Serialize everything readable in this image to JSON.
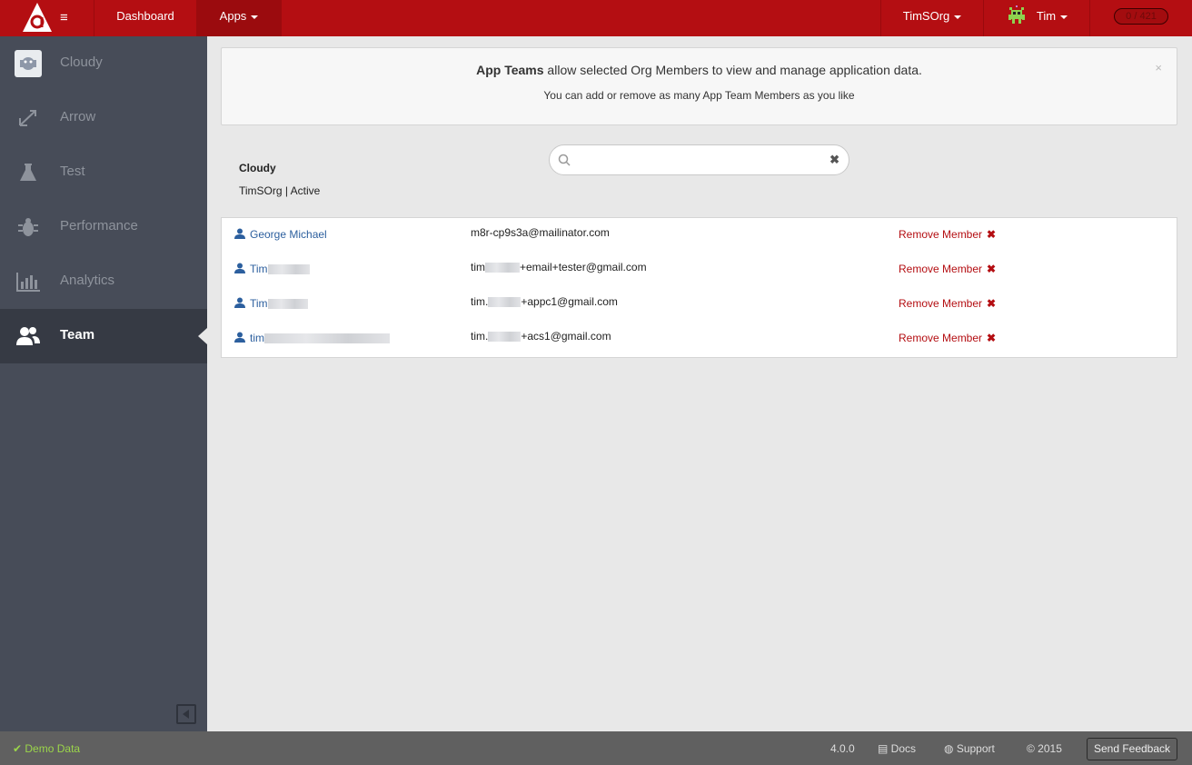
{
  "topbar": {
    "nav": [
      {
        "label": "Dashboard"
      },
      {
        "label": "Apps"
      }
    ],
    "org": "TimSOrg",
    "user": "Tim",
    "counter": "0 / 421"
  },
  "sidebar": {
    "items": [
      {
        "label": "Cloudy",
        "icon": "app-icon"
      },
      {
        "label": "Arrow",
        "icon": "arrow-icon"
      },
      {
        "label": "Test",
        "icon": "flask-icon"
      },
      {
        "label": "Performance",
        "icon": "bug-icon"
      },
      {
        "label": "Analytics",
        "icon": "bar-chart-icon"
      },
      {
        "label": "Team",
        "icon": "team-icon"
      }
    ],
    "active": "Team"
  },
  "notice": {
    "bold": "App Teams",
    "line1": " allow selected Org Members to view and manage application data.",
    "line2": "You can add or remove as many App Team Members as you like",
    "close": "×"
  },
  "app": {
    "name": "Cloudy",
    "meta": "TimSOrg | Active"
  },
  "search": {
    "value": "",
    "placeholder": ""
  },
  "members": [
    {
      "name": "George Michael",
      "email_a": "m8r-cp9s3a@mailinator.com",
      "email_b": "",
      "action": "Remove Member"
    },
    {
      "name": "Tim",
      "email_a": "tim",
      "email_b": "+email+tester@gmail.com",
      "action": "Remove Member"
    },
    {
      "name": "Tim",
      "email_a": "tim.",
      "email_b": "+appc1@gmail.com",
      "action": "Remove Member"
    },
    {
      "name": "tim",
      "email_a": "tim.",
      "email_b": "+acs1@gmail.com",
      "action": "Remove Member"
    }
  ],
  "footer": {
    "demo": "Demo Data",
    "version": "4.0.0",
    "docs": "Docs",
    "support": "Support",
    "copyright": "© 2015",
    "feedback": "Send Feedback"
  },
  "colors": {
    "brand": "#b40e12",
    "sidebar": "#474c58",
    "link": "#2c5f9e",
    "demo": "#9bd54a"
  }
}
